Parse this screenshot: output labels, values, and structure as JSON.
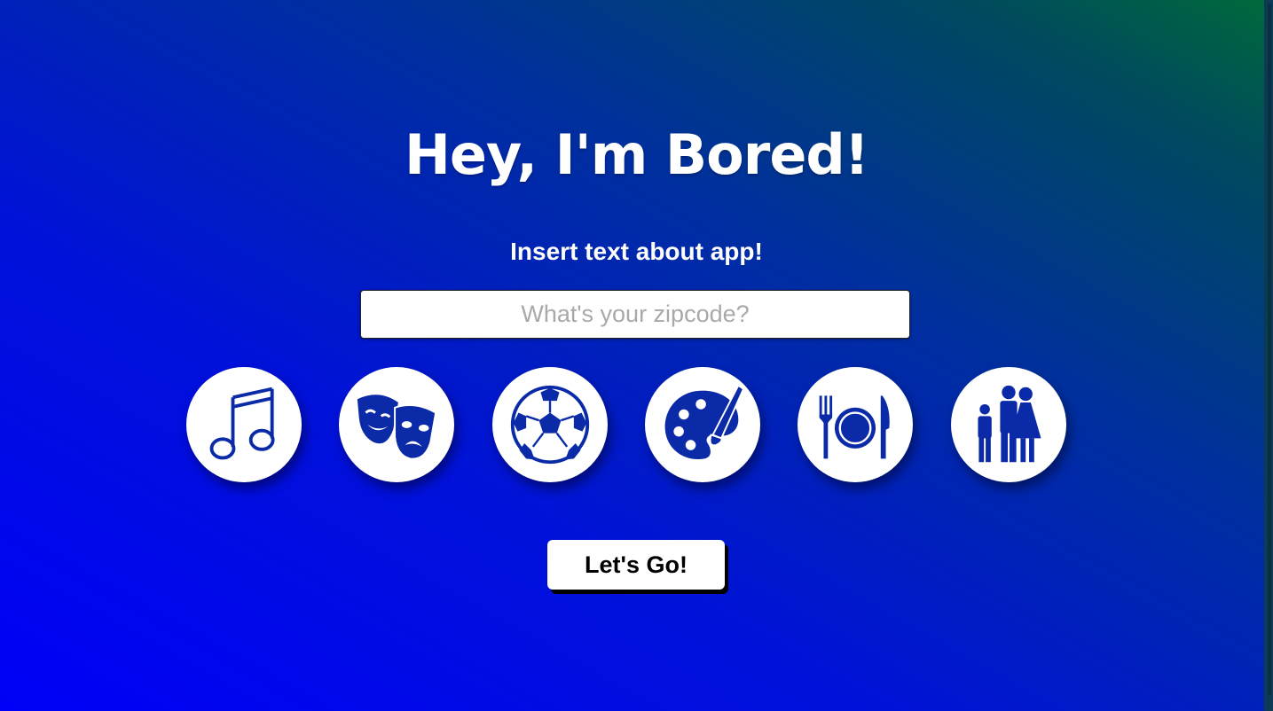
{
  "header": {
    "title": "Hey, I'm Bored!",
    "subtitle": "Insert text about app!"
  },
  "search": {
    "placeholder": "What's your zipcode?",
    "value": ""
  },
  "categories": [
    {
      "icon": "music-notes-icon"
    },
    {
      "icon": "theater-masks-icon"
    },
    {
      "icon": "soccer-ball-icon"
    },
    {
      "icon": "paint-palette-icon"
    },
    {
      "icon": "dining-plate-icon"
    },
    {
      "icon": "family-icon"
    }
  ],
  "action": {
    "go_label": "Let's Go!"
  },
  "colors": {
    "background_start": "#0000f8",
    "background_end": "#006a3a",
    "icon_color": "#0a2aa8",
    "accent": "#ffffff"
  }
}
